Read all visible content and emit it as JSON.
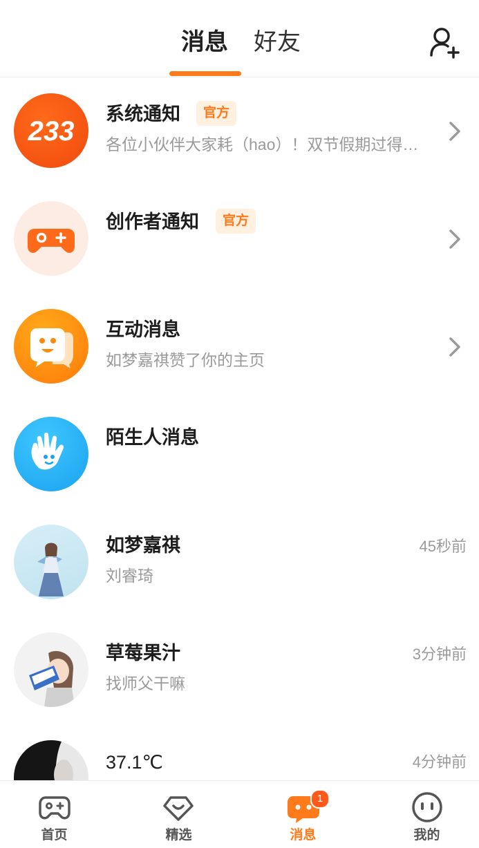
{
  "header": {
    "tabs": [
      {
        "label": "消息",
        "active": true
      },
      {
        "label": "好友",
        "active": false
      }
    ],
    "add_friend_icon": "add-user-icon"
  },
  "conversations": [
    {
      "title": "系统通知",
      "badge": "官方",
      "subtitle": "各位小伙伴大家耗（hao）！双节假期过得…",
      "avatar": "233-logo",
      "has_chevron": true
    },
    {
      "title": "创作者通知",
      "badge": "官方",
      "subtitle": "",
      "avatar": "gamepad-icon",
      "has_chevron": true
    },
    {
      "title": "互动消息",
      "subtitle": "如梦嘉祺赞了你的主页",
      "avatar": "chat-bubble-icon",
      "has_chevron": true
    },
    {
      "title": "陌生人消息",
      "subtitle": "",
      "avatar": "hand-wave-icon",
      "has_chevron": false
    },
    {
      "title": "如梦嘉祺",
      "subtitle": "刘睿琦",
      "time": "45秒前",
      "avatar": "user-avatar"
    },
    {
      "title": "草莓果汁",
      "subtitle": "找师父干嘛",
      "time": "3分钟前",
      "avatar": "user-avatar"
    },
    {
      "title": "37.1℃",
      "subtitle": "",
      "time": "4分钟前",
      "avatar": "user-avatar"
    }
  ],
  "bottom_nav": [
    {
      "label": "首页",
      "icon": "gamepad-icon",
      "active": false
    },
    {
      "label": "精选",
      "icon": "heart-diamond-icon",
      "active": false
    },
    {
      "label": "消息",
      "icon": "message-icon",
      "active": true,
      "badge": "1"
    },
    {
      "label": "我的",
      "icon": "face-icon",
      "active": false
    }
  ],
  "colors": {
    "accent": "#ff7a1a",
    "badge_bg": "#fff0e0",
    "muted_text": "#9a9a9a"
  }
}
